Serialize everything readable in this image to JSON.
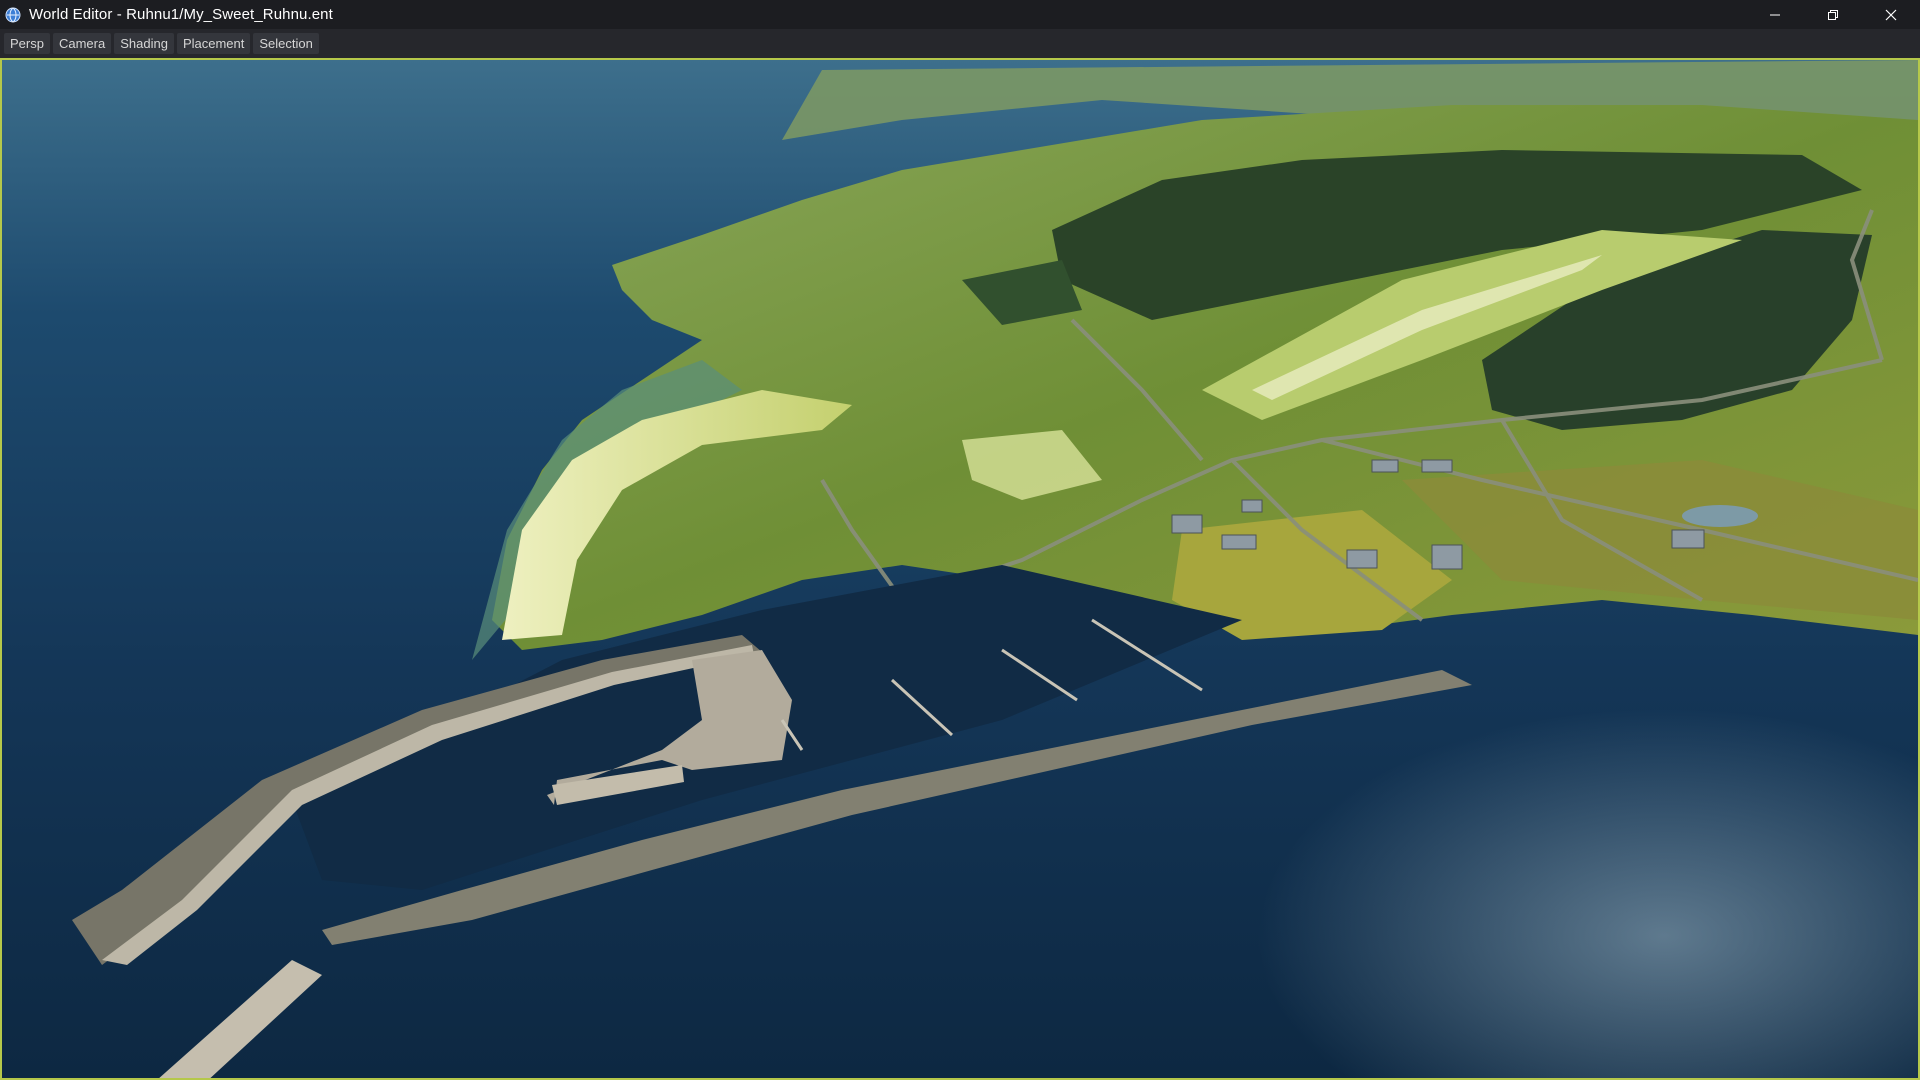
{
  "window": {
    "title": "World Editor - Ruhnu1/My_Sweet_Ruhnu.ent",
    "app_icon": "world-editor-globe-icon",
    "controls": [
      "minimize-icon",
      "restore-icon",
      "close-icon"
    ]
  },
  "toolbar": {
    "buttons": [
      {
        "label": "Persp"
      },
      {
        "label": "Camera"
      },
      {
        "label": "Shading"
      },
      {
        "label": "Placement"
      },
      {
        "label": "Selection"
      }
    ]
  },
  "viewport": {
    "description_colors": {
      "deep_water": "#0f2a45",
      "shallow_water": "#2f6f7a",
      "sand": "#d9dc9a",
      "grass": "#7a9a3a",
      "forest": "#243a24",
      "rock": "#7c7a72",
      "concrete": "#b8b2a4",
      "selection_border": "#b5c84a"
    }
  }
}
